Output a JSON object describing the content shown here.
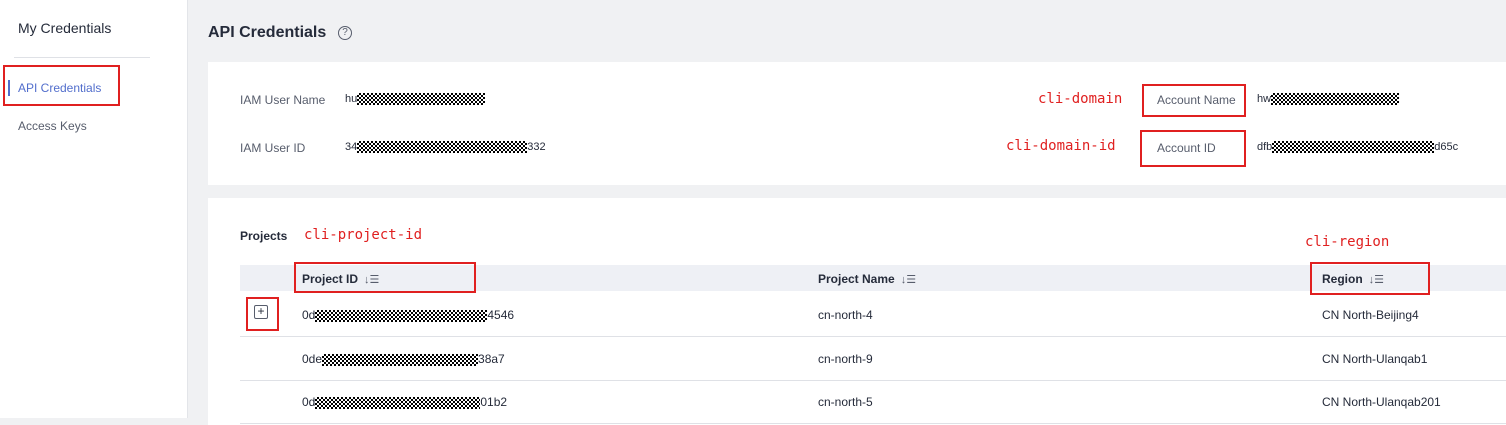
{
  "sidebar": {
    "title": "My Credentials",
    "items": [
      {
        "label": "API Credentials",
        "active": true
      },
      {
        "label": "Access Keys",
        "active": false
      }
    ]
  },
  "header": {
    "title": "API Credentials",
    "help_icon": "question-circle-icon",
    "help_glyph": "?"
  },
  "info": {
    "iam_user_name_label": "IAM User Name",
    "iam_user_name_prefix": "hu",
    "iam_user_id_label": "IAM User ID",
    "iam_user_id_prefix": "34",
    "iam_user_id_suffix": "332",
    "account_name_label": "Account Name",
    "account_name_prefix": "hw",
    "account_id_label": "Account ID",
    "account_id_prefix": "dfb",
    "account_id_suffix": "d65c"
  },
  "annotations": {
    "domain": "cli-domain",
    "domain_id": "cli-domain-id",
    "project_id": "cli-project-id",
    "region": "cli-region",
    "color": "#e02020"
  },
  "projects": {
    "label": "Projects",
    "columns": [
      "Project ID",
      "Project Name",
      "Region"
    ],
    "sort_icon": "sort-icon",
    "sort_glyph": "↓☰",
    "expand_glyph": "+",
    "rows": [
      {
        "id_prefix": "0d",
        "id_suffix": "4546",
        "name": "cn-north-4",
        "region": "CN North-Beijing4"
      },
      {
        "id_prefix": "0de",
        "id_suffix": "38a7",
        "name": "cn-north-9",
        "region": "CN North-Ulanqab1"
      },
      {
        "id_prefix": "0d",
        "id_suffix": "01b2",
        "name": "cn-north-5",
        "region": "CN North-Ulanqab201"
      }
    ]
  },
  "colors": {
    "accent": "#526ecc",
    "background": "#f0f1f3",
    "table_header": "#eef0f5"
  }
}
